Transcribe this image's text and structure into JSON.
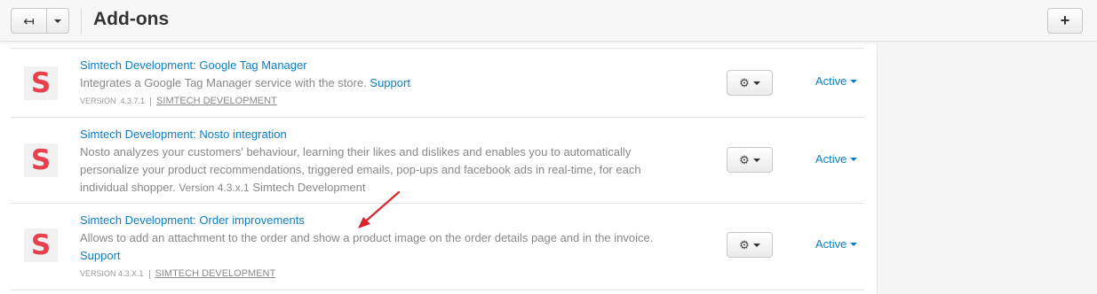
{
  "header": {
    "title": "Add-ons",
    "back_icon": "↤",
    "add_icon": "+"
  },
  "addons": [
    {
      "logo": "S",
      "title": "Simtech Development: Google Tag Manager",
      "description": "Integrates a Google Tag Manager service with the store.",
      "support_link": "Support",
      "version": "VERSION .4.3.7.1",
      "developer": "SIMTECH DEVELOPMENT",
      "status": "Active"
    },
    {
      "logo": "S",
      "title": "Simtech Development: Nosto integration",
      "description": "Nosto analyzes your customers' behaviour, learning their likes and dislikes and enables you to automatically personalize your product recommendations, triggered emails, pop-ups and facebook ads in real-time, for each individual shopper.",
      "version_inline": "Version 4.3.x.1",
      "developer_inline": "Simtech Development",
      "status": "Active"
    },
    {
      "logo": "S",
      "title": "Simtech Development: Order improvements",
      "description": "Allows to add an attachment to the order and show a product image on the order details page and in the invoice.",
      "support_link": "Support",
      "version": "VERSION 4.3.X.1",
      "developer": "SIMTECH DEVELOPMENT",
      "status": "Active"
    }
  ],
  "colors": {
    "link": "#0b7fc7",
    "logo": "#e9404e",
    "arrow": "#d9232d"
  }
}
